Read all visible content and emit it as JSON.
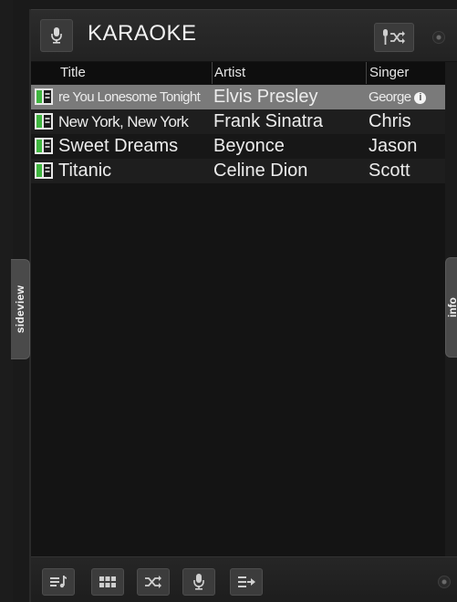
{
  "header": {
    "title": "KARAOKE",
    "icons": [
      "microphone-icon",
      "shuffle-microphone-icon",
      "settings-dot-icon"
    ]
  },
  "side_tabs": {
    "left": "sideview",
    "right": "info"
  },
  "columns": [
    "Title",
    "Artist",
    "Singer"
  ],
  "rows": [
    {
      "title": "re You Lonesome Tonight",
      "artist": "Elvis Presley",
      "singer": "George",
      "selected": true
    },
    {
      "title": "New York, New York",
      "artist": "Frank Sinatra",
      "singer": "Chris",
      "selected": false
    },
    {
      "title": "Sweet Dreams",
      "artist": "Beyonce",
      "singer": "Jason",
      "selected": false
    },
    {
      "title": "Titanic",
      "artist": "Celine Dion",
      "singer": "Scott",
      "selected": false
    }
  ],
  "info_badge": "i",
  "toolbar": {
    "buttons": [
      "add-to-playlist-icon",
      "grid-view-icon",
      "shuffle-icon",
      "microphone-icon",
      "queue-next-icon"
    ]
  },
  "colors": {
    "background": "#141414",
    "header": "#262626",
    "selected_row": "#7a7a7a",
    "accent_green": "#3fb63f",
    "text": "#ececec"
  }
}
